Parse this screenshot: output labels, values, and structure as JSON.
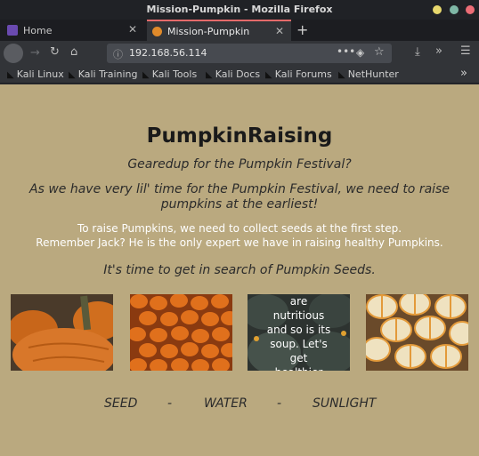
{
  "window": {
    "title": "Mission-Pumpkin - Mozilla Firefox"
  },
  "tabs": [
    {
      "label": "Home"
    },
    {
      "label": "Mission-Pumpkin"
    }
  ],
  "nav": {
    "url": "192.168.56.114"
  },
  "bookmarks": [
    {
      "label": "Kali Linux"
    },
    {
      "label": "Kali Training"
    },
    {
      "label": "Kali Tools"
    },
    {
      "label": "Kali Docs"
    },
    {
      "label": "Kali Forums"
    },
    {
      "label": "NetHunter"
    }
  ],
  "page": {
    "heading": "PumpkinRaising",
    "tagline": "Gearedup for the Pumpkin Festival?",
    "intro": "As we have very lil' time for the Pumpkin Festival, we need to raise pumpkins at the earliest!",
    "seed_line1": "To raise Pumpkins, we need to collect seeds at the first step.",
    "seed_line2": "Remember Jack? He is the only expert we have in raising healthy Pumpkins.",
    "search_line": "It's time to get in search of Pumpkin Seeds.",
    "soup_text_lines": [
      "are",
      "nutritious",
      "and so is its",
      "soup. Let's",
      "get",
      "healthier"
    ],
    "footer": [
      "SEED",
      "-",
      "WATER",
      "-",
      "SUNLIGHT"
    ]
  },
  "colors": {
    "page_bg": "#baa97f",
    "active_tab_accent": "#e56a6a"
  }
}
